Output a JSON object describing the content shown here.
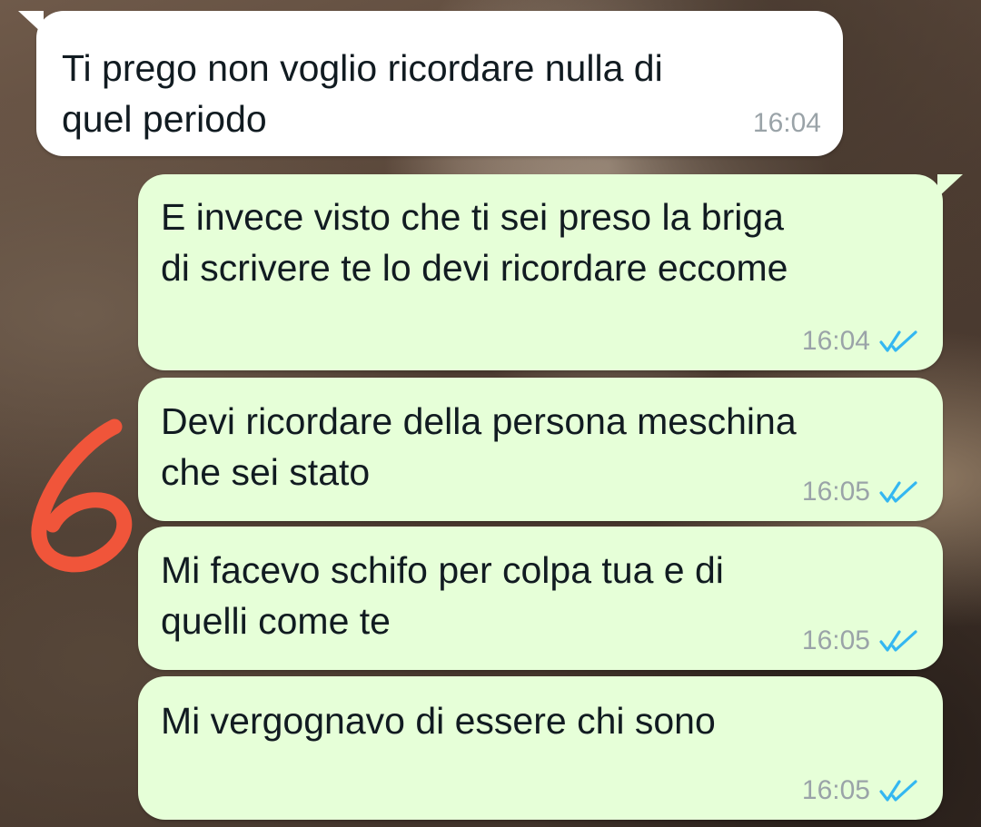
{
  "colors": {
    "incoming_bubble": "#ffffff",
    "outgoing_bubble": "#e6ffd8",
    "timestamp": "#9aa3a8",
    "read_receipt": "#34b7f1",
    "annotation": "#f0553a"
  },
  "messages": [
    {
      "direction": "incoming",
      "text": "Ti prego non voglio ricordare nulla di\nquel periodo",
      "time": "16:04"
    },
    {
      "direction": "outgoing",
      "text": "E invece visto che ti sei preso la briga\ndi scrivere te lo devi ricordare eccome",
      "time": "16:04",
      "status_icon": "double-check-icon"
    },
    {
      "direction": "outgoing",
      "text": "Devi ricordare della persona meschina\nche sei stato",
      "time": "16:05",
      "status_icon": "double-check-icon"
    },
    {
      "direction": "outgoing",
      "text": "Mi facevo schifo per colpa tua e di\nquelli come te",
      "time": "16:05",
      "status_icon": "double-check-icon"
    },
    {
      "direction": "outgoing",
      "text": "Mi vergognavo di essere chi sono",
      "time": "16:05",
      "status_icon": "double-check-icon"
    }
  ],
  "annotation": {
    "text": "6",
    "icon": "handwritten-number-annotation"
  }
}
